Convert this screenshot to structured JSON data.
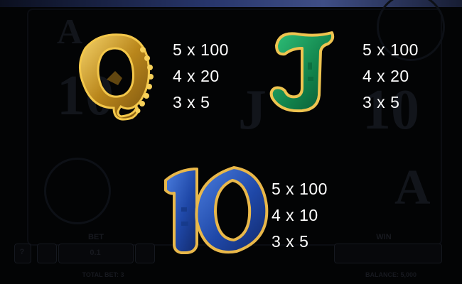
{
  "symbols": [
    {
      "id": "Q",
      "color_fill": "#b8891c",
      "color_edge": "#f3c74a",
      "payouts": [
        "5 x 100",
        "4 x 20",
        "3 x 5"
      ]
    },
    {
      "id": "J",
      "color_fill": "#158c52",
      "color_edge": "#efc450",
      "payouts": [
        "5 x 100",
        "4 x 20",
        "3 x 5"
      ]
    },
    {
      "id": "10",
      "color_fill": "#1f48a8",
      "color_edge": "#e9b84a",
      "payouts": [
        "5 x 100",
        "4 x 10",
        "3 x 5"
      ]
    }
  ],
  "background": {
    "bet_label": "BET",
    "bet_value": "0.1",
    "total_bet_label": "TOTAL BET: 3",
    "balance_label": "BALANCE: 5,000",
    "help_label": "?",
    "win_label": "WIN"
  },
  "colors": {
    "background": "#030405",
    "text": "#ffffff",
    "top_bar": "#3f4e86"
  }
}
